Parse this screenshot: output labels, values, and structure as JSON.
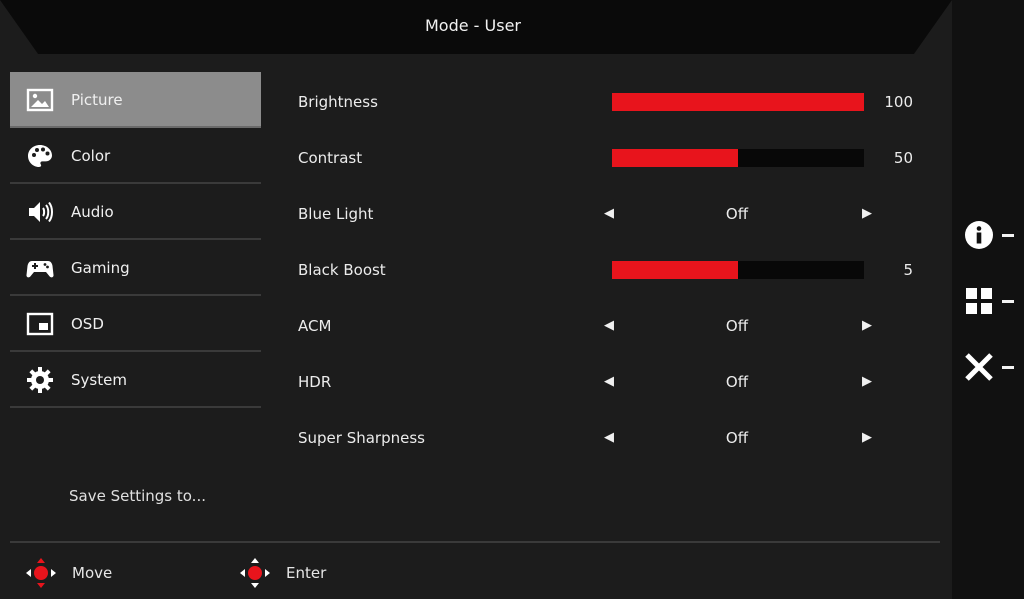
{
  "header": {
    "title": "Mode - User"
  },
  "nav": {
    "items": [
      {
        "label": "Picture",
        "icon": "picture-icon",
        "active": true
      },
      {
        "label": "Color",
        "icon": "palette-icon",
        "active": false
      },
      {
        "label": "Audio",
        "icon": "speaker-icon",
        "active": false
      },
      {
        "label": "Gaming",
        "icon": "gamepad-icon",
        "active": false
      },
      {
        "label": "OSD",
        "icon": "osd-window-icon",
        "active": false
      },
      {
        "label": "System",
        "icon": "gear-icon",
        "active": false
      }
    ],
    "save_label": "Save Settings to..."
  },
  "settings": [
    {
      "label": "Brightness",
      "type": "slider",
      "value": "100",
      "level": 1.0
    },
    {
      "label": "Contrast",
      "type": "slider",
      "value": "50",
      "level": 0.5
    },
    {
      "label": "Blue Light",
      "type": "option",
      "value": "Off"
    },
    {
      "label": "Black Boost",
      "type": "slider",
      "value": "5",
      "level": 0.5
    },
    {
      "label": "ACM",
      "type": "option",
      "value": "Off"
    },
    {
      "label": "HDR",
      "type": "option",
      "value": "Off"
    },
    {
      "label": "Super Sharpness",
      "type": "option",
      "value": "Off"
    }
  ],
  "footer": {
    "move_label": "Move",
    "enter_label": "Enter"
  },
  "hotkeys": [
    {
      "icon": "info-icon"
    },
    {
      "icon": "menu-grid-icon"
    },
    {
      "icon": "close-icon"
    }
  ],
  "colors": {
    "accent": "#e8141c",
    "background": "#1c1c1c",
    "active_item": "#8c8c8c"
  }
}
